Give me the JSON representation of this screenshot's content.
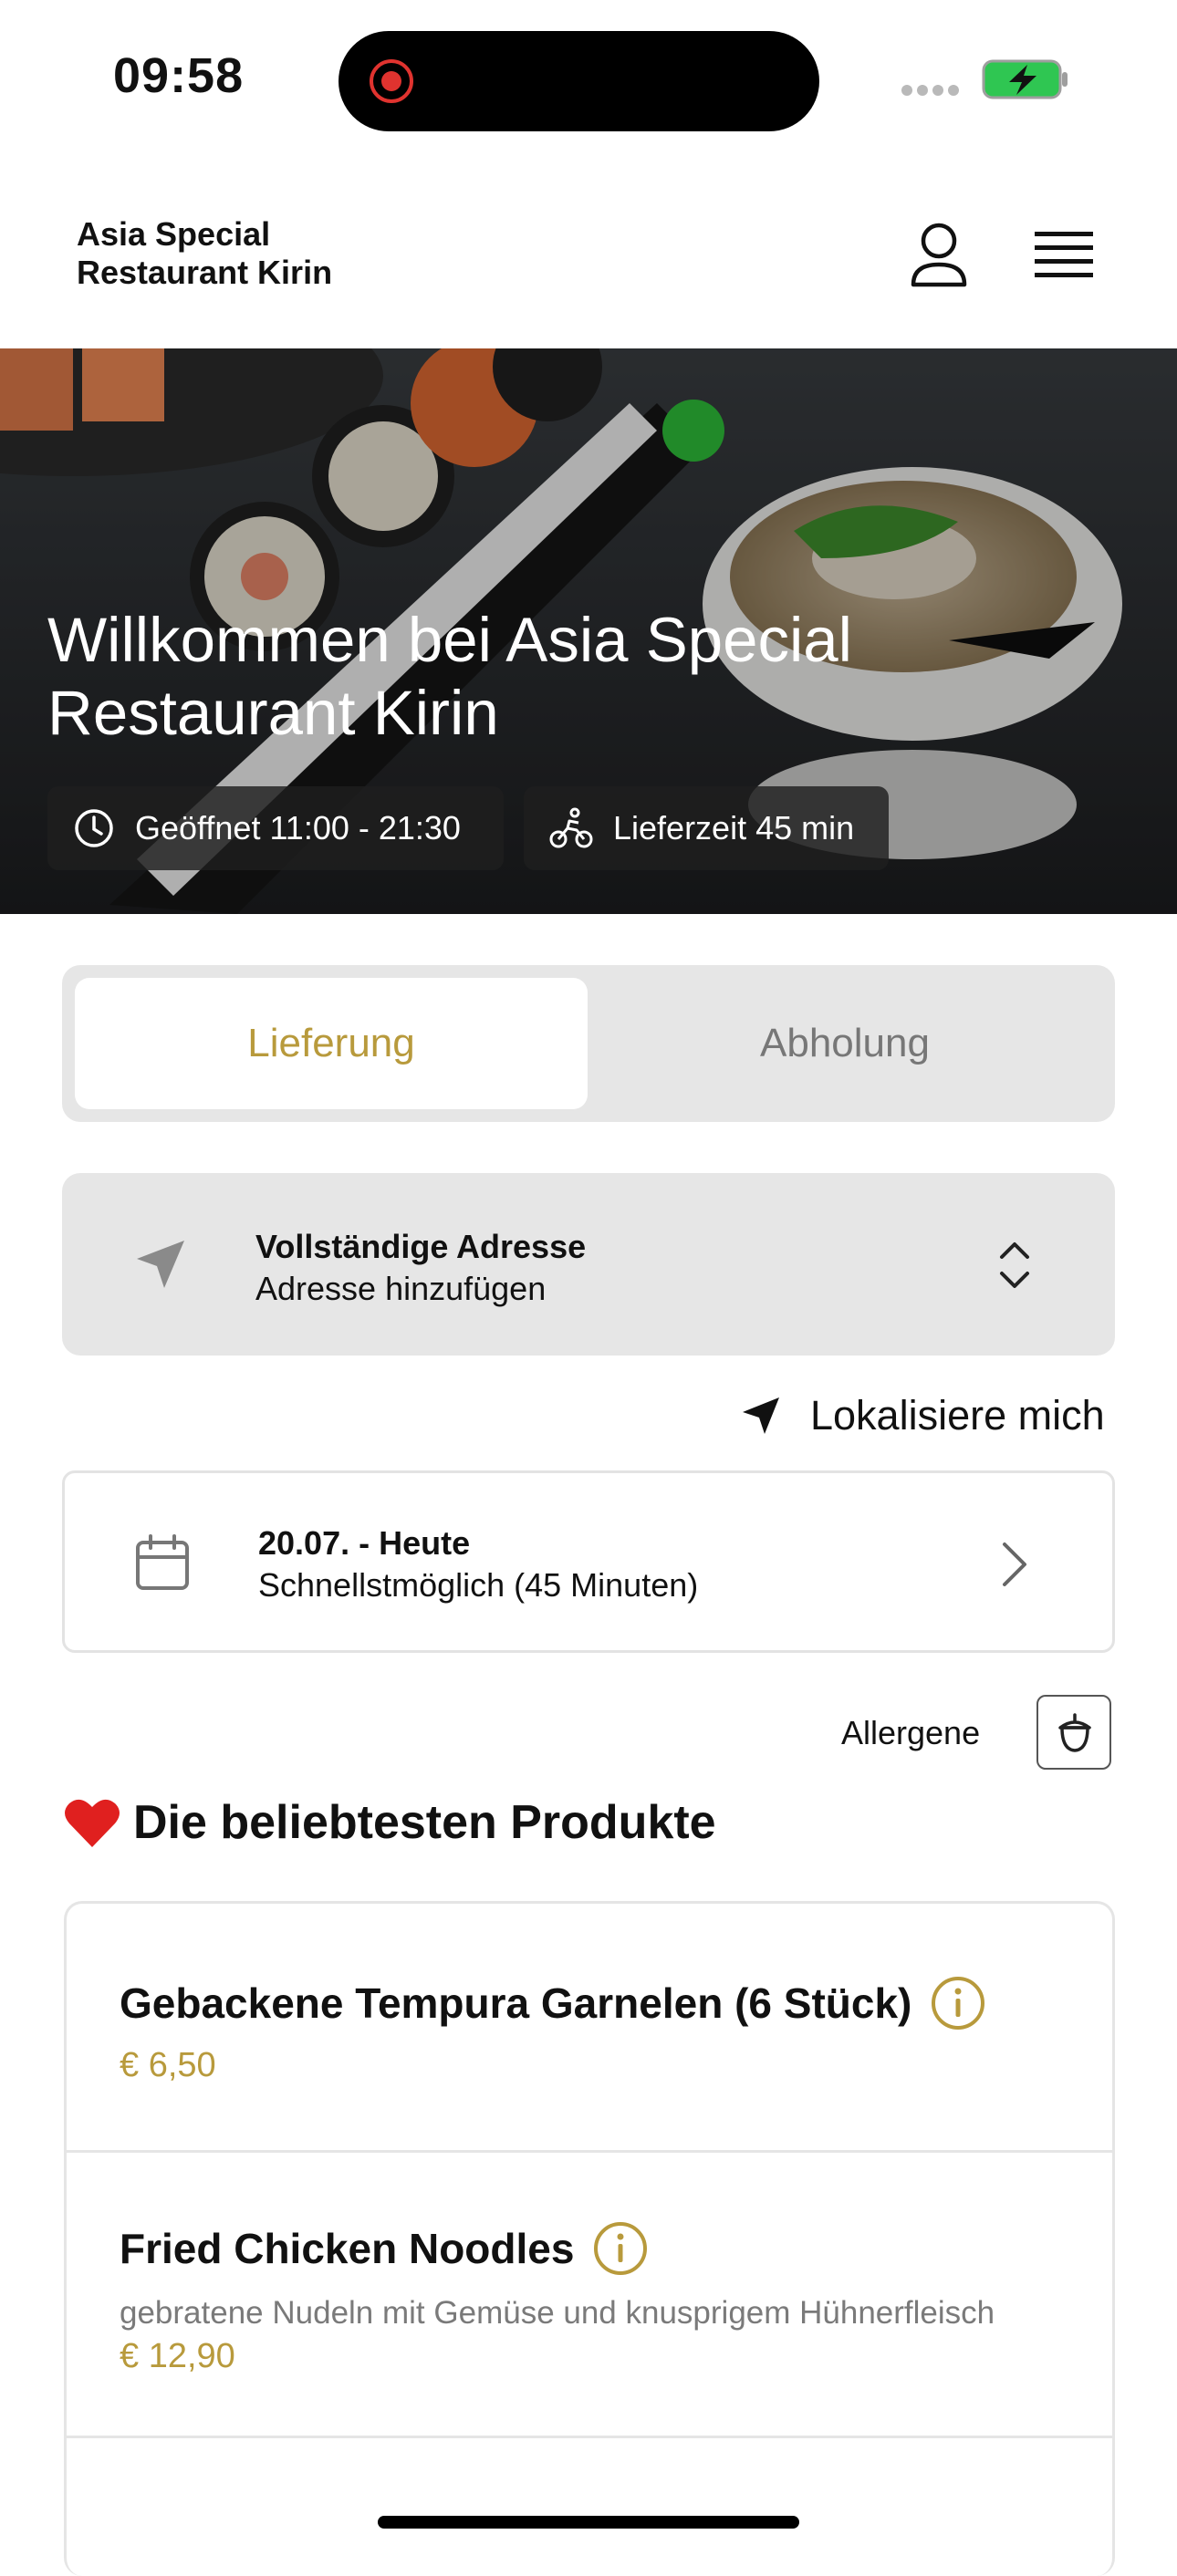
{
  "status_bar": {
    "time": "09:58"
  },
  "header": {
    "brand_line1": "Asia Special",
    "brand_line2": "Restaurant Kirin"
  },
  "hero": {
    "title": "Willkommen bei Asia Special Restaurant Kirin",
    "opening_hours": "Geöffnet 11:00 - 21:30",
    "delivery_time": "Lieferzeit 45 min"
  },
  "order_mode": {
    "tabs": [
      {
        "label": "Lieferung",
        "active": true
      },
      {
        "label": "Abholung",
        "active": false
      }
    ],
    "accent_color": "#b89a3c"
  },
  "address": {
    "title": "Vollständige Adresse",
    "subtitle": "Adresse hinzufügen",
    "locate_label": "Lokalisiere mich"
  },
  "schedule": {
    "date": "20.07. - Heute",
    "time": "Schnellstmöglich (45 Minuten)"
  },
  "allergens": {
    "label": "Allergene"
  },
  "popular": {
    "title": "Die beliebtesten Produkte",
    "products": [
      {
        "name": "Gebackene Tempura Garnelen (6 Stück)",
        "description": "",
        "price": "€ 6,50"
      },
      {
        "name": "Fried Chicken Noodles",
        "description": "gebratene Nudeln mit Gemüse und knusprigem Hühnerfleisch",
        "price": "€ 12,90"
      }
    ]
  }
}
